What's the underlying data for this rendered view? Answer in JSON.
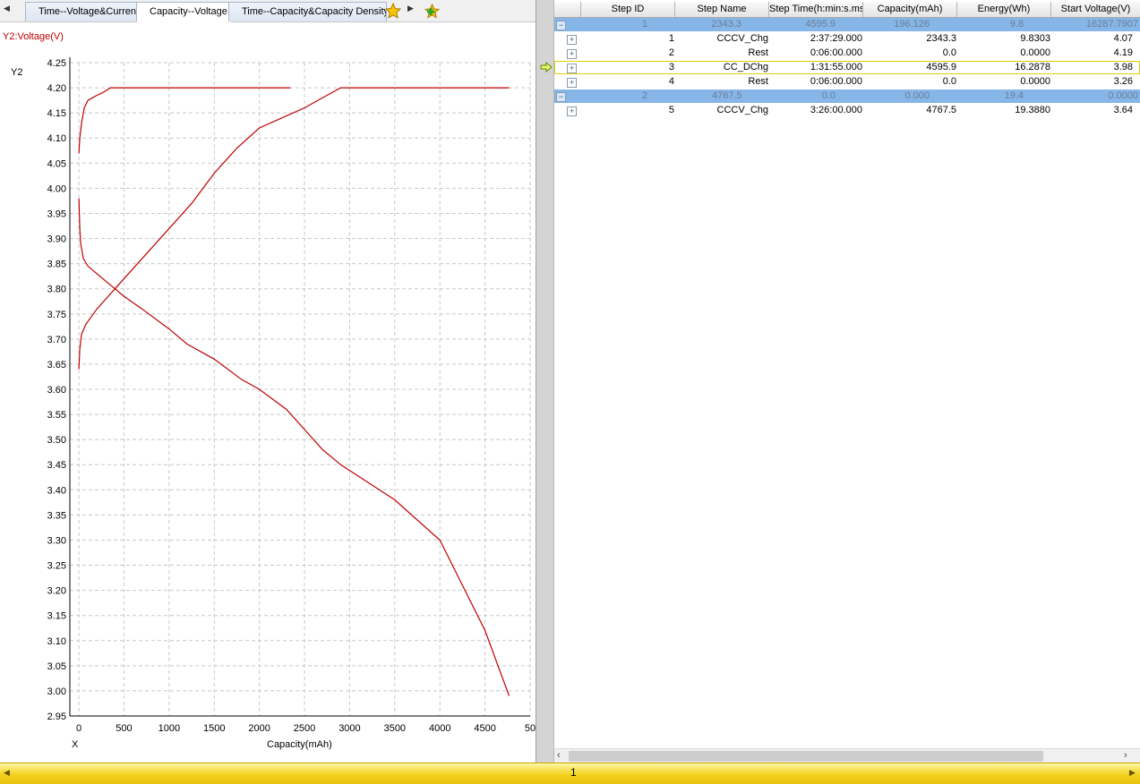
{
  "tabs": {
    "items": [
      {
        "label": "Time--Voltage&Current"
      },
      {
        "label": "Capacity--Voltage"
      },
      {
        "label": "Time--Capacity&Capacity Density"
      }
    ]
  },
  "chart": {
    "y_axis_title": "Y2:Voltage(V)",
    "y_axis_name": "Y2",
    "x_axis_name": "X",
    "x_axis_label": "Capacity(mAh)",
    "line_color": "#c00000"
  },
  "chart_data": {
    "type": "line",
    "xlabel": "Capacity(mAh)",
    "ylabel": "Y2:Voltage(V)",
    "xlim": [
      -100,
      5000
    ],
    "ylim": [
      2.95,
      4.25
    ],
    "x_ticks": [
      "0",
      "500",
      "1000",
      "1500",
      "2000",
      "2500",
      "3000",
      "3500",
      "4000",
      "4500",
      "50"
    ],
    "y_ticks": [
      "2.95",
      "3.00",
      "3.05",
      "3.10",
      "3.15",
      "3.20",
      "3.25",
      "3.30",
      "3.35",
      "3.40",
      "3.45",
      "3.50",
      "3.55",
      "3.60",
      "3.65",
      "3.70",
      "3.75",
      "3.80",
      "3.85",
      "3.90",
      "3.95",
      "4.00",
      "4.05",
      "4.10",
      "4.15",
      "4.20",
      "4.25"
    ],
    "grid": true,
    "series": [
      {
        "name": "",
        "x": [
          0,
          10,
          30,
          60,
          100,
          150,
          200,
          260,
          350,
          420,
          500,
          1000,
          2000,
          2343
        ],
        "y": [
          4.07,
          4.1,
          4.13,
          4.16,
          4.175,
          4.18,
          4.185,
          4.19,
          4.2,
          4.2,
          4.2,
          4.2,
          4.2,
          4.2
        ]
      },
      {
        "name": "",
        "x": [
          0,
          10,
          20,
          50,
          100,
          200,
          300,
          400,
          500,
          700,
          1000,
          1200,
          1500,
          1800,
          2000,
          2300,
          2500,
          2700,
          2900,
          3500,
          4000,
          4500,
          4767
        ],
        "y": [
          3.98,
          3.92,
          3.89,
          3.86,
          3.845,
          3.83,
          3.815,
          3.8,
          3.785,
          3.76,
          3.72,
          3.69,
          3.66,
          3.62,
          3.6,
          3.56,
          3.52,
          3.48,
          3.45,
          3.38,
          3.3,
          3.12,
          2.99
        ]
      },
      {
        "name": "",
        "x": [
          0,
          10,
          30,
          80,
          200,
          400,
          600,
          800,
          1000,
          1250,
          1500,
          1750,
          2000,
          2500,
          2750,
          2900,
          3500,
          4000,
          4767
        ],
        "y": [
          3.64,
          3.68,
          3.71,
          3.73,
          3.76,
          3.8,
          3.84,
          3.88,
          3.92,
          3.97,
          4.03,
          4.08,
          4.12,
          4.16,
          4.185,
          4.2,
          4.2,
          4.2,
          4.2
        ]
      }
    ]
  },
  "grid": {
    "columns": [
      "Step ID",
      "Step Name",
      "Step Time(h:min:s.ms)",
      "Capacity(mAh)",
      "Energy(Wh)",
      "Start Voltage(V)"
    ],
    "groups": [
      {
        "cells": [
          "1",
          "2343.3",
          "4595.9",
          "196.126",
          "9.8",
          "16287.7907"
        ]
      },
      {
        "cells": [
          "2",
          "4767.5",
          "0.0",
          "0.000",
          "19.4",
          "0.0000"
        ]
      }
    ],
    "rows": [
      {
        "cells": [
          "1",
          "CCCV_Chg",
          "2:37:29.000",
          "2343.3",
          "9.8303",
          "4.07"
        ]
      },
      {
        "cells": [
          "2",
          "Rest",
          "0:06:00.000",
          "0.0",
          "0.0000",
          "4.19"
        ]
      },
      {
        "cells": [
          "3",
          "CC_DChg",
          "1:31:55.000",
          "4595.9",
          "16.2878",
          "3.98"
        ]
      },
      {
        "cells": [
          "4",
          "Rest",
          "0:06:00.000",
          "0.0",
          "0.0000",
          "3.26"
        ]
      },
      {
        "cells": [
          "5",
          "CCCV_Chg",
          "3:26:00.000",
          "4767.5",
          "19.3880",
          "3.64"
        ]
      }
    ],
    "expand_glyph": "+",
    "collapse_glyph": "−"
  },
  "statusbar": {
    "page_number": "1"
  },
  "icons": {
    "star": "star-icon",
    "add_star": "add-favorite-icon",
    "current_row": "current-row-arrow-icon"
  }
}
